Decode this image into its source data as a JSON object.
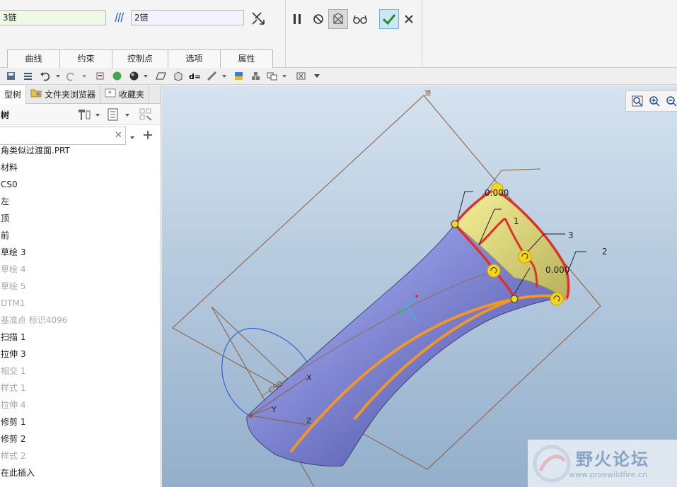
{
  "dashboard": {
    "chain_left_value": "3链",
    "chain_right_value": "2链",
    "tabs": [
      "曲线",
      "约束",
      "控制点",
      "选项",
      "属性"
    ],
    "actions": {
      "pause": "pause-icon",
      "stop": "stop-icon",
      "preview": "preview-icon",
      "verify": "glasses-icon",
      "ok": "check-icon",
      "cancel": "close-icon"
    }
  },
  "left_panel": {
    "tabs": [
      "型树",
      "文件夹浏览器",
      "收藏夹"
    ],
    "tree_header": "树",
    "search_value": "",
    "tree_items": [
      {
        "label": "角类似过渡面.PRT",
        "dim": false
      },
      {
        "label": "材料",
        "dim": false
      },
      {
        "label": "CS0",
        "dim": false
      },
      {
        "label": "左",
        "dim": false
      },
      {
        "label": "顶",
        "dim": false
      },
      {
        "label": "前",
        "dim": false
      },
      {
        "label": "草绘 3",
        "dim": false
      },
      {
        "label": "草绘 4",
        "dim": true
      },
      {
        "label": "草绘 5",
        "dim": true
      },
      {
        "label": "DTM1",
        "dim": true
      },
      {
        "label": "基准点 标识4096",
        "dim": true
      },
      {
        "label": "扫描 1",
        "dim": false
      },
      {
        "label": "拉伸 3",
        "dim": false
      },
      {
        "label": "相交 1",
        "dim": true
      },
      {
        "label": "样式 1",
        "dim": true
      },
      {
        "label": "拉伸 4",
        "dim": true
      },
      {
        "label": "修剪 1",
        "dim": false
      },
      {
        "label": "修剪 2",
        "dim": false
      },
      {
        "label": "样式 2",
        "dim": true
      },
      {
        "label": "在此插入",
        "dim": false
      }
    ]
  },
  "graphics": {
    "plane_label": "顶",
    "dim_top": "0.000",
    "dim_right": "0.000",
    "chain_num_1": "1",
    "chain_num_2": "2",
    "chain_num_3": "3",
    "csys_label": "CS0",
    "axis_x": "X",
    "axis_y": "Y",
    "axis_z": "Z",
    "watermark_title": "野火论坛",
    "watermark_url": "www.proewildfire.cn",
    "colors": {
      "surface": "#7f86d6",
      "highlight_yellow": "#f6e03a",
      "chain_red": "#e0302a",
      "chain_orange": "#f0962a"
    }
  }
}
